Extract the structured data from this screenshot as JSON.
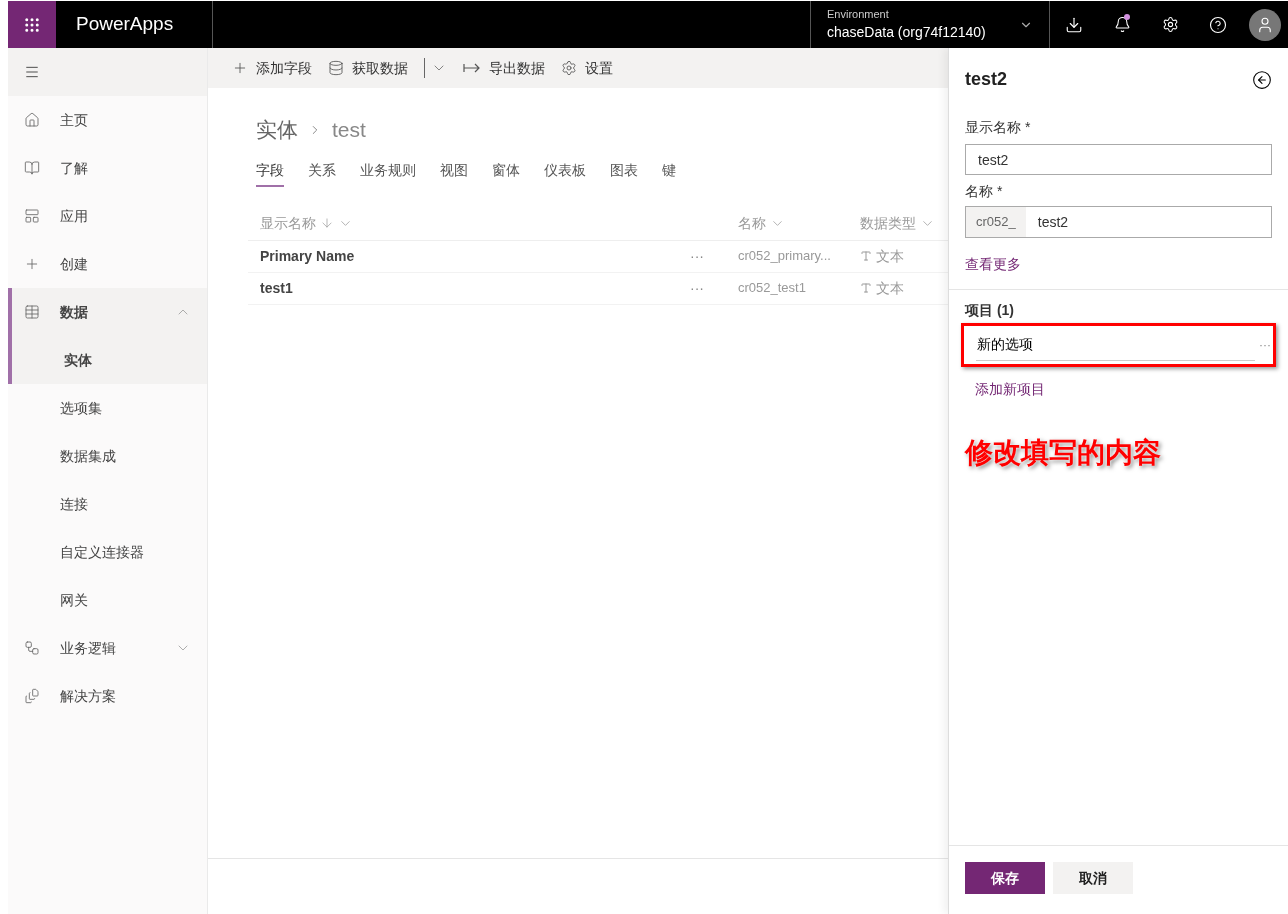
{
  "header": {
    "app_name": "PowerApps",
    "environment_label": "Environment",
    "environment_value": "chaseData (org74f12140)",
    "has_notification": true
  },
  "sidebar": {
    "items": [
      {
        "label": "主页",
        "selected": false
      },
      {
        "label": "了解",
        "selected": false
      },
      {
        "label": "应用",
        "selected": false
      },
      {
        "label": "创建",
        "selected": false
      },
      {
        "label": "数据",
        "selected": true,
        "expanded": true,
        "children": [
          {
            "label": "实体",
            "selected": true
          },
          {
            "label": "选项集",
            "selected": false
          },
          {
            "label": "数据集成",
            "selected": false
          },
          {
            "label": "连接",
            "selected": false
          },
          {
            "label": "自定义连接器",
            "selected": false
          },
          {
            "label": "网关",
            "selected": false
          }
        ]
      },
      {
        "label": "业务逻辑",
        "selected": false,
        "expanded": false
      },
      {
        "label": "解决方案",
        "selected": false
      }
    ]
  },
  "command_bar": [
    {
      "label": "添加字段",
      "split": false
    },
    {
      "label": "获取数据",
      "split": true
    },
    {
      "label": "导出数据",
      "split": false
    },
    {
      "label": "设置",
      "split": false
    }
  ],
  "breadcrumb": {
    "parent": "实体",
    "current": "test"
  },
  "tabs": [
    {
      "label": "字段",
      "selected": true
    },
    {
      "label": "关系",
      "selected": false
    },
    {
      "label": "业务规则",
      "selected": false
    },
    {
      "label": "视图",
      "selected": false
    },
    {
      "label": "窗体",
      "selected": false
    },
    {
      "label": "仪表板",
      "selected": false
    },
    {
      "label": "图表",
      "selected": false
    },
    {
      "label": "键",
      "selected": false
    }
  ],
  "table": {
    "columns": [
      {
        "label": "显示名称",
        "sorted": true
      },
      {
        "label": "名称",
        "sorted": false
      },
      {
        "label": "数据类型",
        "sorted": false
      }
    ],
    "rows": [
      {
        "display_name": "Primary Name",
        "more": "···",
        "name": "cr052_primary...",
        "type": "文本"
      },
      {
        "display_name": "test1",
        "more": "···",
        "name": "cr052_test1",
        "type": "文本"
      }
    ]
  },
  "panel": {
    "title": "test2",
    "display_name": {
      "label": "显示名称",
      "required_mark": "*",
      "value": "test2"
    },
    "name": {
      "label": "名称",
      "required_mark": "*",
      "prefix": "cr052_",
      "value": "test2"
    },
    "see_more": "查看更多",
    "items_heading": "项目 (1)",
    "items": [
      {
        "value": "新的选项",
        "more": "···"
      }
    ],
    "add_item": "添加新项目",
    "annotation": "修改填写的内容",
    "buttons": [
      {
        "label": "保存",
        "kind": "primary"
      },
      {
        "label": "取消",
        "kind": "secondary"
      }
    ]
  }
}
